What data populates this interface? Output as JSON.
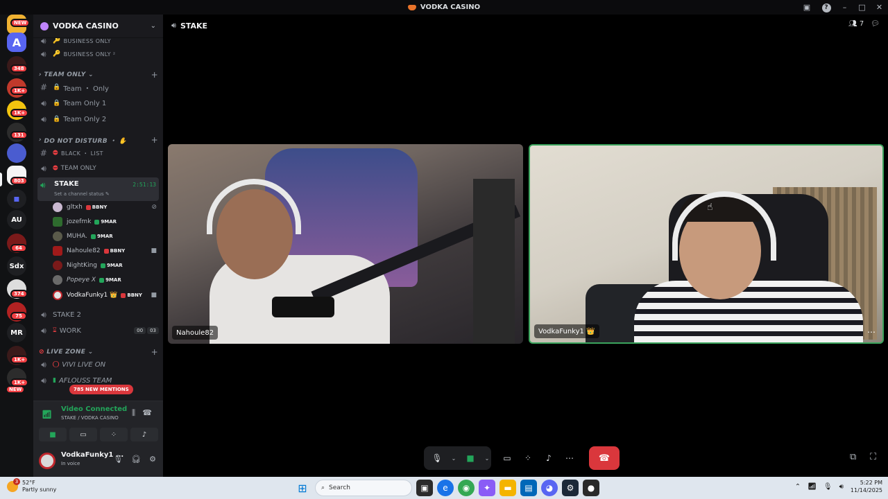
{
  "window": {
    "title": "VODKA CASINO"
  },
  "rail": {
    "badges": [
      "NEW",
      "348",
      "1K+",
      "1K+",
      "131",
      "803",
      "64",
      "374",
      "75",
      "1K+",
      "1K+",
      "NEW"
    ],
    "text_servers": [
      "AU",
      "Sdx",
      "MR"
    ]
  },
  "guild": {
    "name": "VODKA CASINO"
  },
  "channels": {
    "business_1": "BUSINESS ONLY",
    "business_2": "BUSINESS ONLY ²",
    "cat_team": "TEAM ONLY",
    "team_1": "Team ・ Only",
    "team_2": "Team Only 1",
    "team_3": "Team Only 2",
    "cat_dnd": "DO NOT DISTURB ・ ✋",
    "black_list": "BLACK ・ LIST",
    "team_only": "TEAM ONLY",
    "stake": "STAKE",
    "stake_status": "Set a channel status ✎",
    "stake_timer": "2:51:13",
    "stake2": "STAKE 2",
    "work": "WORK",
    "work_badge_1": "00",
    "work_badge_2": "03",
    "cat_live": "LIVE ZONE",
    "vivi": "VIVI LIVE ON",
    "aflouss": "AFLOUSS TEAM",
    "mentions": "785 NEW MENTIONS"
  },
  "members": [
    {
      "name": "gltxh",
      "tag": "BBNY",
      "tag_color": "#da373c"
    },
    {
      "name": "jozefmk",
      "tag": "9MAR",
      "tag_color": "#23a55a"
    },
    {
      "name": "MUHA.",
      "tag": "9MAR",
      "tag_color": "#23a55a"
    },
    {
      "name": "Nahoule82",
      "tag": "BBNY",
      "tag_color": "#da373c"
    },
    {
      "name": "NightKing",
      "tag": "9MAR",
      "tag_color": "#23a55a"
    },
    {
      "name": "Popeye X",
      "tag": "9MAR",
      "tag_color": "#23a55a"
    },
    {
      "name": "VodkaFunky1 👑",
      "tag": "BBNY",
      "tag_color": "#da373c"
    }
  ],
  "voice": {
    "status": "Video Connected",
    "channel": "STAKE / VODKA CASINO"
  },
  "user": {
    "name": "VodkaFunky1 ...",
    "status": "In voice"
  },
  "stage": {
    "channel": "STAKE",
    "participants_count": "7",
    "tile_left_name": "Nahoule82",
    "tile_right_name": "VodkaFunky1 👑"
  },
  "taskbar": {
    "weather_temp": "52°F",
    "weather_desc": "Partly sunny",
    "weather_badge": "3",
    "search_placeholder": "Search",
    "time": "5:22 PM",
    "date": "11/14/2025"
  },
  "colors": {
    "accent_green": "#23a55a",
    "danger_red": "#da373c",
    "sidebar_bg": "#1a1a1e"
  }
}
